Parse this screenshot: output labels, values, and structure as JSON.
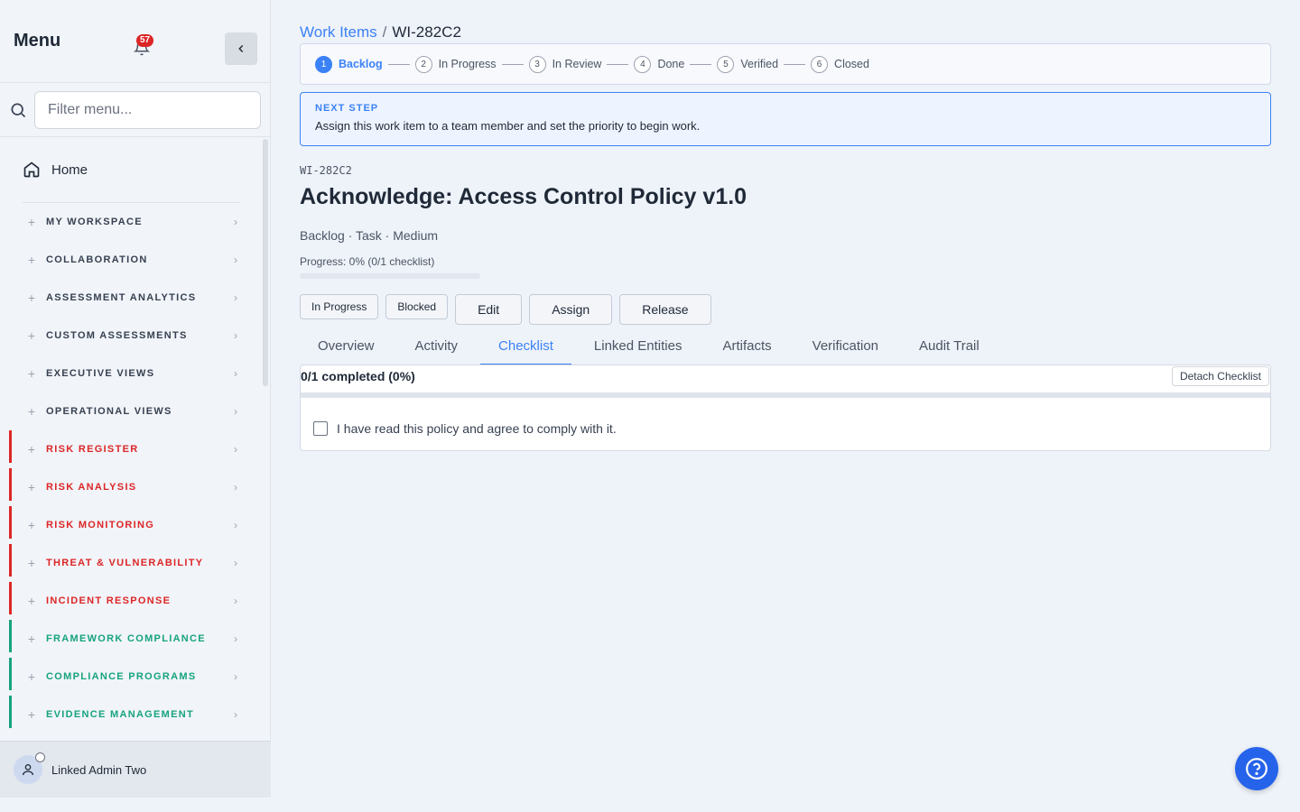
{
  "sidebar": {
    "title": "Menu",
    "notification_count": "57",
    "filter_placeholder": "Filter menu...",
    "home_label": "Home",
    "items": [
      {
        "label": "MY WORKSPACE",
        "color": "#374151",
        "accent": ""
      },
      {
        "label": "COLLABORATION",
        "color": "#374151",
        "accent": ""
      },
      {
        "label": "ASSESSMENT ANALYTICS",
        "color": "#374151",
        "accent": ""
      },
      {
        "label": "CUSTOM ASSESSMENTS",
        "color": "#374151",
        "accent": ""
      },
      {
        "label": "EXECUTIVE VIEWS",
        "color": "#374151",
        "accent": ""
      },
      {
        "label": "OPERATIONAL VIEWS",
        "color": "#374151",
        "accent": ""
      },
      {
        "label": "RISK REGISTER",
        "color": "#dc2626",
        "accent": "#dc2626"
      },
      {
        "label": "RISK ANALYSIS",
        "color": "#dc2626",
        "accent": "#dc2626"
      },
      {
        "label": "RISK MONITORING",
        "color": "#dc2626",
        "accent": "#dc2626"
      },
      {
        "label": "THREAT & VULNERABILITY",
        "color": "#dc2626",
        "accent": "#dc2626"
      },
      {
        "label": "INCIDENT RESPONSE",
        "color": "#dc2626",
        "accent": "#dc2626"
      },
      {
        "label": "FRAMEWORK COMPLIANCE",
        "color": "#16a37f",
        "accent": "#16a37f"
      },
      {
        "label": "COMPLIANCE PROGRAMS",
        "color": "#16a37f",
        "accent": "#16a37f"
      },
      {
        "label": "EVIDENCE MANAGEMENT",
        "color": "#16a37f",
        "accent": "#16a37f"
      }
    ],
    "user_name": "Linked Admin Two"
  },
  "breadcrumb": {
    "parent": "Work Items",
    "separator": "/",
    "current": "WI-282C2"
  },
  "stepper": [
    {
      "num": "1",
      "label": "Backlog",
      "active": true
    },
    {
      "num": "2",
      "label": "In Progress",
      "active": false
    },
    {
      "num": "3",
      "label": "In Review",
      "active": false
    },
    {
      "num": "4",
      "label": "Done",
      "active": false
    },
    {
      "num": "5",
      "label": "Verified",
      "active": false
    },
    {
      "num": "6",
      "label": "Closed",
      "active": false
    }
  ],
  "next_step": {
    "title": "NEXT STEP",
    "text": "Assign this work item to a team member and set the priority to begin work."
  },
  "work_item": {
    "id": "WI-282C2",
    "title": "Acknowledge: Access Control Policy v1.0",
    "meta": "Backlog · Task · Medium",
    "progress_label": "Progress: 0% (0/1 checklist)",
    "progress_fraction": 0
  },
  "actions": {
    "in_progress": "In Progress",
    "blocked": "Blocked",
    "edit": "Edit",
    "assign": "Assign",
    "release": "Release"
  },
  "tabs": [
    {
      "label": "Overview",
      "active": false
    },
    {
      "label": "Activity",
      "active": false
    },
    {
      "label": "Checklist",
      "active": true
    },
    {
      "label": "Linked Entities",
      "active": false
    },
    {
      "label": "Artifacts",
      "active": false
    },
    {
      "label": "Verification",
      "active": false
    },
    {
      "label": "Audit Trail",
      "active": false
    }
  ],
  "checklist": {
    "summary": "0/1 completed (0%)",
    "detach_label": "Detach Checklist",
    "items": [
      {
        "text": "I have read this policy and agree to comply with it.",
        "checked": false
      }
    ]
  },
  "colors": {
    "accent": "#3b82f6",
    "danger": "#dc2626",
    "success": "#16a37f"
  },
  "icons": {
    "help": "help-circle-icon",
    "bell": "bell-icon",
    "collapse": "chevron-left-icon",
    "search": "search-icon",
    "home": "home-icon",
    "user": "user-icon"
  }
}
